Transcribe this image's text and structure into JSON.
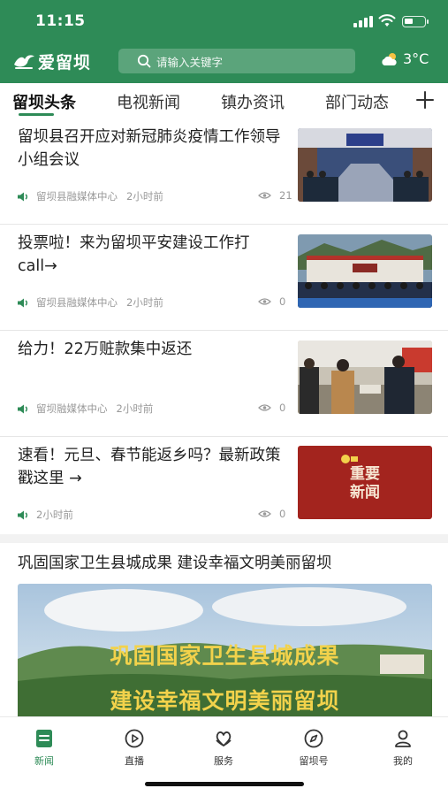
{
  "status_bar": {
    "time": "11:15"
  },
  "header": {
    "app_name": "爱留坝",
    "search_placeholder": "请输入关键字",
    "temperature": "3°C",
    "weather_icon": "partly-cloudy-icon"
  },
  "tabs": [
    {
      "label": "留坝头条",
      "active": true
    },
    {
      "label": "电视新闻"
    },
    {
      "label": "镇办资讯"
    },
    {
      "label": "部门动态"
    }
  ],
  "news": [
    {
      "title": "留坝县召开应对新冠肺炎疫情工作领导小组会议",
      "source": "留坝县融媒体中心",
      "time": "2小时前",
      "views": "21"
    },
    {
      "title": "投票啦！来为留坝平安建设工作打call→",
      "source": "留坝县融媒体中心",
      "time": "2小时前",
      "views": "0"
    },
    {
      "title": "给力！22万赃款集中返还",
      "source": "留坝融媒体中心",
      "time": "2小时前",
      "views": "0"
    },
    {
      "title": "速看！元旦、春节能返乡吗？最新政策戳这里 →",
      "source": "",
      "time": "2小时前",
      "views": "0",
      "thumb_text_line1": "重要",
      "thumb_text_line2": "新闻"
    }
  ],
  "feature": {
    "title": "巩固国家卫生县城成果  建设幸福文明美丽留坝",
    "banner_line1": "巩固国家卫生县城成果",
    "banner_line2": "建设幸福文明美丽留坝"
  },
  "bottom_nav": [
    {
      "label": "新闻",
      "icon": "news-icon",
      "active": true
    },
    {
      "label": "直播",
      "icon": "live-play-icon"
    },
    {
      "label": "服务",
      "icon": "service-icon"
    },
    {
      "label": "留坝号",
      "icon": "compass-icon"
    },
    {
      "label": "我的",
      "icon": "profile-icon"
    }
  ],
  "colors": {
    "brand_green": "#2e8b57",
    "banner_red": "#a3241e",
    "banner_text": "#f2d24b"
  }
}
